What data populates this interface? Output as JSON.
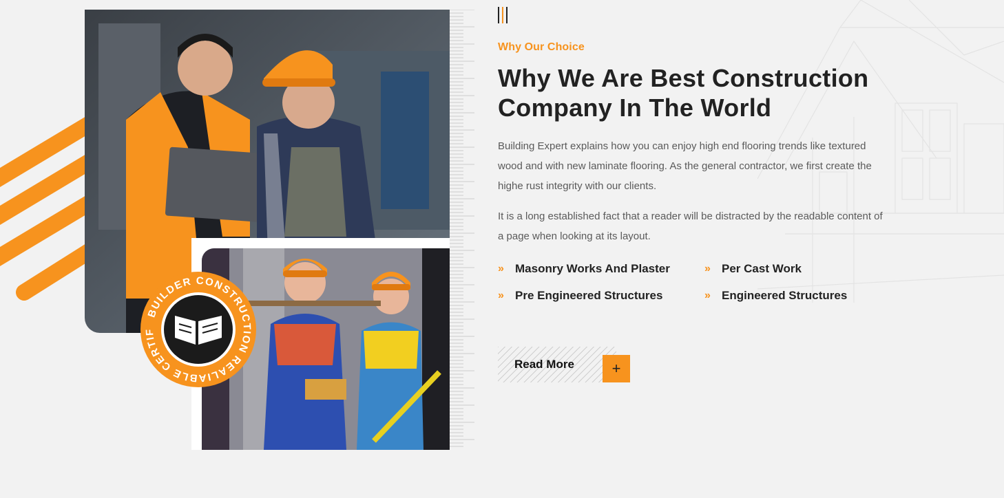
{
  "section": {
    "subtitle": "Why Our Choice",
    "title": "Why We Are Best Construction Company In The World",
    "paragraphs": [
      "Building Expert explains how you can enjoy high end flooring trends like textured wood and with new laminate flooring. As the general contractor, we first create the highe rust integrity with our clients.",
      "It is a long established fact that a reader will be distracted by the readable content of a page when looking at its layout."
    ],
    "features": [
      "Masonry Works And Plaster",
      "Per Cast Work",
      "Pre Engineered Structures",
      "Engineered Structures"
    ],
    "cta_label": "Read More",
    "cta_icon": "+"
  },
  "badge": {
    "text": "BUILDER CONSTRUCTION REALIABLE CERTIFIED"
  },
  "colors": {
    "accent": "#f7931e",
    "heading": "#222222",
    "body_text": "#5a5a5a",
    "background": "#f2f2f2",
    "badge_center": "#1b1b1b"
  },
  "icons": {
    "feature_bullet": "double-chevron-right-icon",
    "cta": "plus-icon",
    "badge": "building-icon"
  }
}
